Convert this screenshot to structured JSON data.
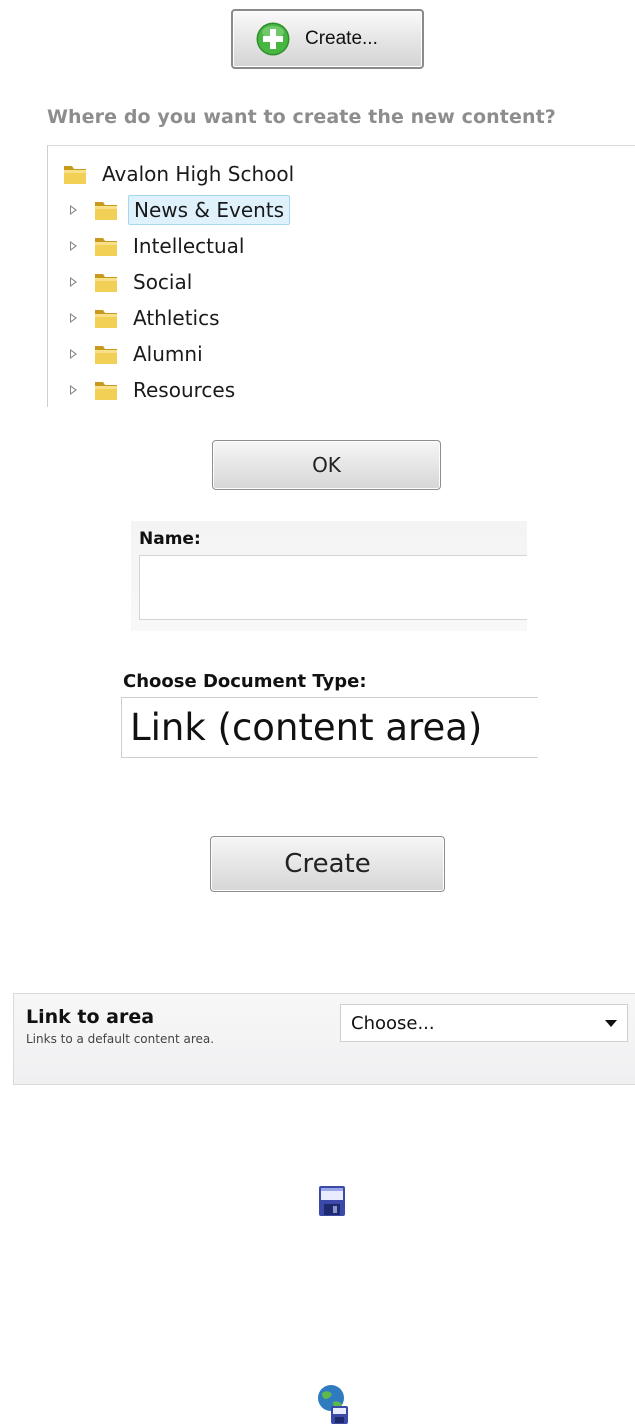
{
  "toolbar": {
    "create_label": "Create...",
    "icon": "green-plus-icon"
  },
  "destination": {
    "question": "Where do you want to create the new content?",
    "root": "Avalon High School",
    "items": [
      {
        "label": "News & Events",
        "selected": true
      },
      {
        "label": "Intellectual",
        "selected": false
      },
      {
        "label": "Social",
        "selected": false
      },
      {
        "label": "Athletics",
        "selected": false
      },
      {
        "label": "Alumni",
        "selected": false
      },
      {
        "label": "Resources",
        "selected": false
      }
    ],
    "ok_label": "OK"
  },
  "name_field": {
    "label": "Name:",
    "value": ""
  },
  "document_type": {
    "label": "Choose Document Type:",
    "value": "Link (content area)"
  },
  "create_button": {
    "label": "Create"
  },
  "link_to_area": {
    "title": "Link to area",
    "description": "Links to a default content area.",
    "select_value": "Choose..."
  },
  "icons": {
    "save": "floppy-disk-icon",
    "publish": "globe-save-icon"
  },
  "colors": {
    "selection_bg": "#dff1fb",
    "selection_border": "#a5d6f2",
    "folder": "#e8c03a",
    "plus": "#3fa93a"
  }
}
